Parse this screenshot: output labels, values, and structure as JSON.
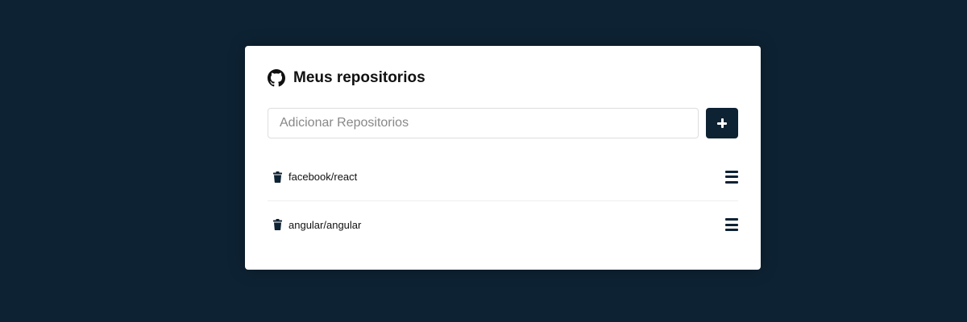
{
  "header": {
    "title": "Meus repositorios",
    "icon": "github-icon"
  },
  "form": {
    "input_value": "",
    "input_placeholder": "Adicionar Repositorios",
    "add_button_icon": "plus-icon"
  },
  "repositories": [
    {
      "name": "facebook/react",
      "delete_icon": "trash-icon",
      "detail_icon": "menu-bars-icon"
    },
    {
      "name": "angular/angular",
      "delete_icon": "trash-icon",
      "detail_icon": "menu-bars-icon"
    }
  ],
  "colors": {
    "background": "#0d2233",
    "card": "#ffffff",
    "accent": "#0d2233"
  }
}
